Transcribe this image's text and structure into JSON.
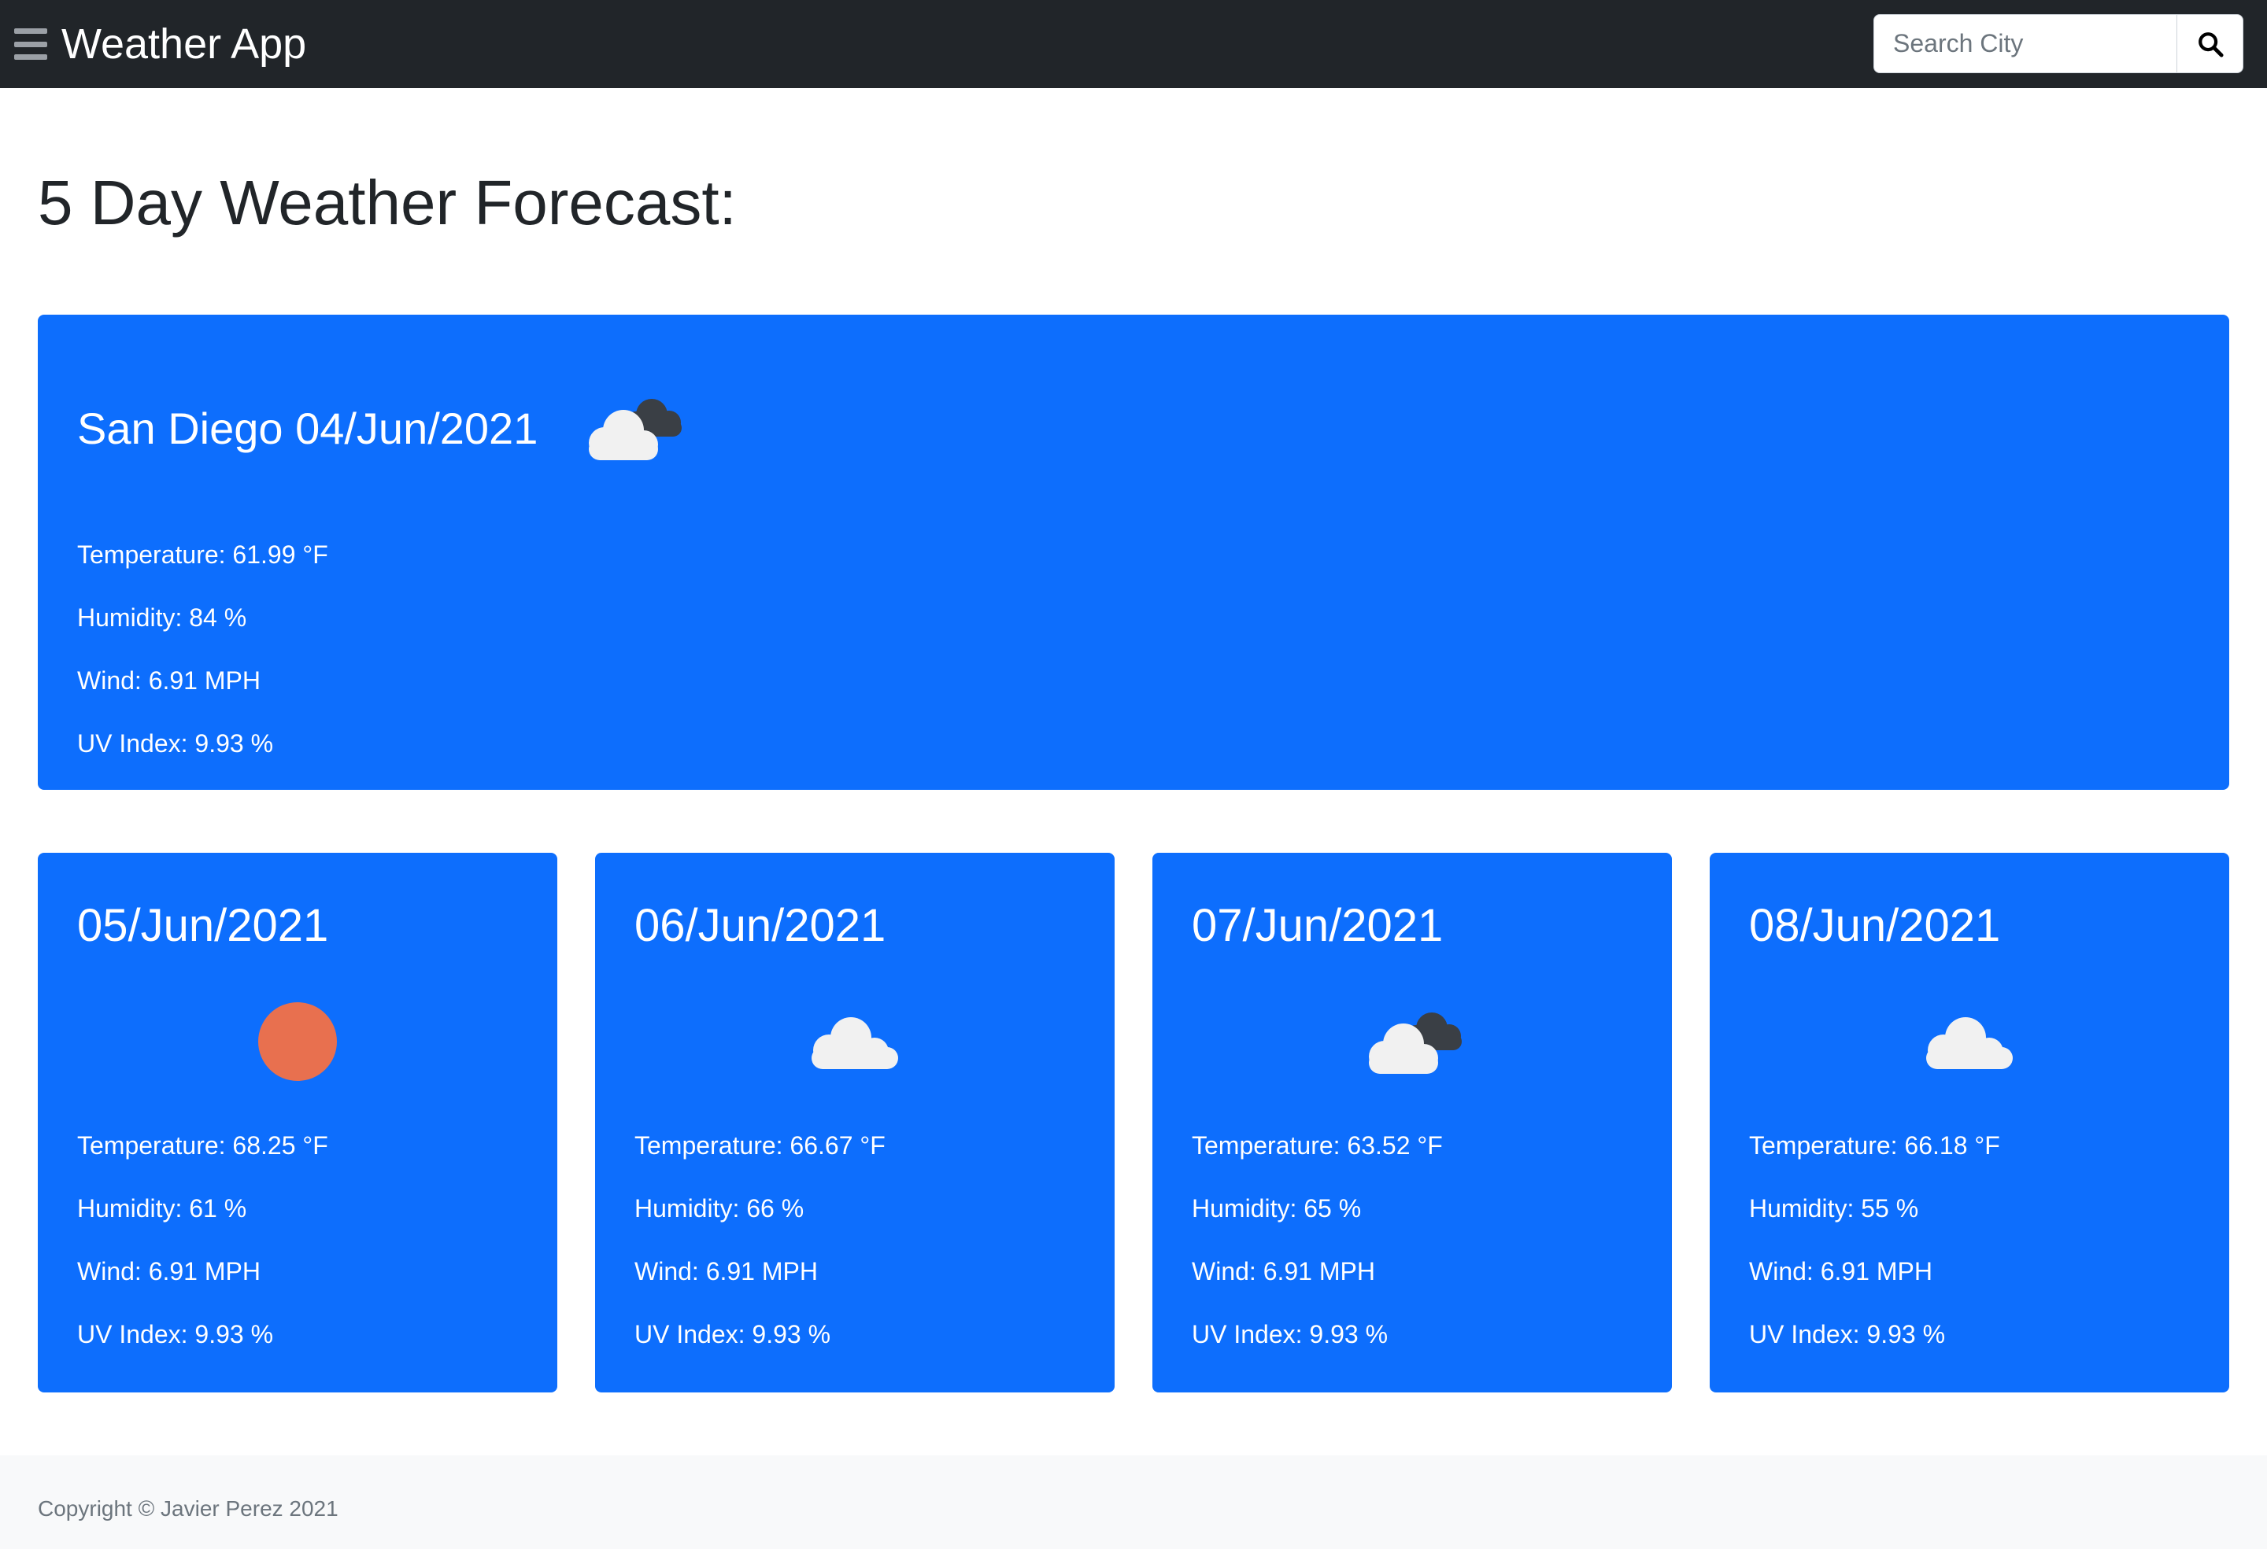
{
  "navbar": {
    "brand": "Weather App",
    "search_placeholder": "Search City"
  },
  "page_title": "5 Day Weather Forecast:",
  "current": {
    "title": "San Diego 04/Jun/2021",
    "icon": "partly-cloudy-icon",
    "temperature": "Temperature: 61.99 °F",
    "humidity": "Humidity: 84 %",
    "wind": "Wind: 6.91 MPH",
    "uv": "UV Index: 9.93 %"
  },
  "forecast": [
    {
      "date": "05/Jun/2021",
      "icon": "sun-icon",
      "temperature": "Temperature: 68.25 °F",
      "humidity": "Humidity: 61 %",
      "wind": "Wind: 6.91 MPH",
      "uv": "UV Index: 9.93 %"
    },
    {
      "date": "06/Jun/2021",
      "icon": "cloud-icon",
      "temperature": "Temperature: 66.67 °F",
      "humidity": "Humidity: 66 %",
      "wind": "Wind: 6.91 MPH",
      "uv": "UV Index: 9.93 %"
    },
    {
      "date": "07/Jun/2021",
      "icon": "partly-cloudy-icon",
      "temperature": "Temperature: 63.52 °F",
      "humidity": "Humidity: 65 %",
      "wind": "Wind: 6.91 MPH",
      "uv": "UV Index: 9.93 %"
    },
    {
      "date": "08/Jun/2021",
      "icon": "cloud-icon",
      "temperature": "Temperature: 66.18 °F",
      "humidity": "Humidity: 55 %",
      "wind": "Wind: 6.91 MPH",
      "uv": "UV Index: 9.93 %"
    }
  ],
  "footer": {
    "copyright": "Copyright © Javier Perez 2021"
  },
  "colors": {
    "navbar": "#212529",
    "card": "#0d6efd",
    "sun": "#e8704f",
    "footer": "#f8f9fa"
  }
}
